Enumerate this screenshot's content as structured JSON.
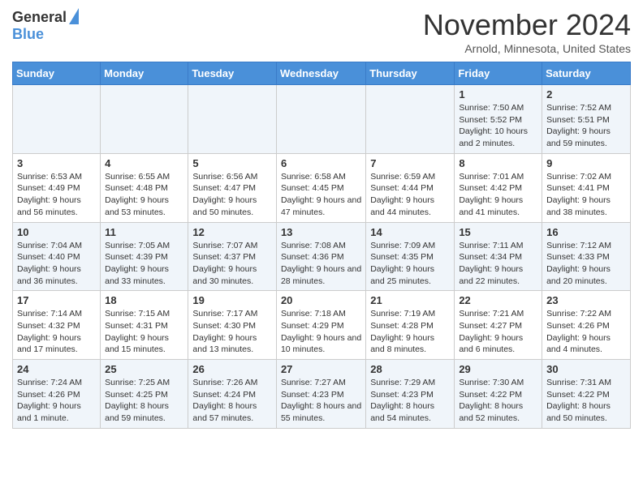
{
  "header": {
    "logo_general": "General",
    "logo_blue": "Blue",
    "month_title": "November 2024",
    "location": "Arnold, Minnesota, United States"
  },
  "calendar": {
    "days_of_week": [
      "Sunday",
      "Monday",
      "Tuesday",
      "Wednesday",
      "Thursday",
      "Friday",
      "Saturday"
    ],
    "weeks": [
      [
        {
          "day": "",
          "info": ""
        },
        {
          "day": "",
          "info": ""
        },
        {
          "day": "",
          "info": ""
        },
        {
          "day": "",
          "info": ""
        },
        {
          "day": "",
          "info": ""
        },
        {
          "day": "1",
          "info": "Sunrise: 7:50 AM\nSunset: 5:52 PM\nDaylight: 10 hours and 2 minutes."
        },
        {
          "day": "2",
          "info": "Sunrise: 7:52 AM\nSunset: 5:51 PM\nDaylight: 9 hours and 59 minutes."
        }
      ],
      [
        {
          "day": "3",
          "info": "Sunrise: 6:53 AM\nSunset: 4:49 PM\nDaylight: 9 hours and 56 minutes."
        },
        {
          "day": "4",
          "info": "Sunrise: 6:55 AM\nSunset: 4:48 PM\nDaylight: 9 hours and 53 minutes."
        },
        {
          "day": "5",
          "info": "Sunrise: 6:56 AM\nSunset: 4:47 PM\nDaylight: 9 hours and 50 minutes."
        },
        {
          "day": "6",
          "info": "Sunrise: 6:58 AM\nSunset: 4:45 PM\nDaylight: 9 hours and 47 minutes."
        },
        {
          "day": "7",
          "info": "Sunrise: 6:59 AM\nSunset: 4:44 PM\nDaylight: 9 hours and 44 minutes."
        },
        {
          "day": "8",
          "info": "Sunrise: 7:01 AM\nSunset: 4:42 PM\nDaylight: 9 hours and 41 minutes."
        },
        {
          "day": "9",
          "info": "Sunrise: 7:02 AM\nSunset: 4:41 PM\nDaylight: 9 hours and 38 minutes."
        }
      ],
      [
        {
          "day": "10",
          "info": "Sunrise: 7:04 AM\nSunset: 4:40 PM\nDaylight: 9 hours and 36 minutes."
        },
        {
          "day": "11",
          "info": "Sunrise: 7:05 AM\nSunset: 4:39 PM\nDaylight: 9 hours and 33 minutes."
        },
        {
          "day": "12",
          "info": "Sunrise: 7:07 AM\nSunset: 4:37 PM\nDaylight: 9 hours and 30 minutes."
        },
        {
          "day": "13",
          "info": "Sunrise: 7:08 AM\nSunset: 4:36 PM\nDaylight: 9 hours and 28 minutes."
        },
        {
          "day": "14",
          "info": "Sunrise: 7:09 AM\nSunset: 4:35 PM\nDaylight: 9 hours and 25 minutes."
        },
        {
          "day": "15",
          "info": "Sunrise: 7:11 AM\nSunset: 4:34 PM\nDaylight: 9 hours and 22 minutes."
        },
        {
          "day": "16",
          "info": "Sunrise: 7:12 AM\nSunset: 4:33 PM\nDaylight: 9 hours and 20 minutes."
        }
      ],
      [
        {
          "day": "17",
          "info": "Sunrise: 7:14 AM\nSunset: 4:32 PM\nDaylight: 9 hours and 17 minutes."
        },
        {
          "day": "18",
          "info": "Sunrise: 7:15 AM\nSunset: 4:31 PM\nDaylight: 9 hours and 15 minutes."
        },
        {
          "day": "19",
          "info": "Sunrise: 7:17 AM\nSunset: 4:30 PM\nDaylight: 9 hours and 13 minutes."
        },
        {
          "day": "20",
          "info": "Sunrise: 7:18 AM\nSunset: 4:29 PM\nDaylight: 9 hours and 10 minutes."
        },
        {
          "day": "21",
          "info": "Sunrise: 7:19 AM\nSunset: 4:28 PM\nDaylight: 9 hours and 8 minutes."
        },
        {
          "day": "22",
          "info": "Sunrise: 7:21 AM\nSunset: 4:27 PM\nDaylight: 9 hours and 6 minutes."
        },
        {
          "day": "23",
          "info": "Sunrise: 7:22 AM\nSunset: 4:26 PM\nDaylight: 9 hours and 4 minutes."
        }
      ],
      [
        {
          "day": "24",
          "info": "Sunrise: 7:24 AM\nSunset: 4:26 PM\nDaylight: 9 hours and 1 minute."
        },
        {
          "day": "25",
          "info": "Sunrise: 7:25 AM\nSunset: 4:25 PM\nDaylight: 8 hours and 59 minutes."
        },
        {
          "day": "26",
          "info": "Sunrise: 7:26 AM\nSunset: 4:24 PM\nDaylight: 8 hours and 57 minutes."
        },
        {
          "day": "27",
          "info": "Sunrise: 7:27 AM\nSunset: 4:23 PM\nDaylight: 8 hours and 55 minutes."
        },
        {
          "day": "28",
          "info": "Sunrise: 7:29 AM\nSunset: 4:23 PM\nDaylight: 8 hours and 54 minutes."
        },
        {
          "day": "29",
          "info": "Sunrise: 7:30 AM\nSunset: 4:22 PM\nDaylight: 8 hours and 52 minutes."
        },
        {
          "day": "30",
          "info": "Sunrise: 7:31 AM\nSunset: 4:22 PM\nDaylight: 8 hours and 50 minutes."
        }
      ]
    ]
  }
}
